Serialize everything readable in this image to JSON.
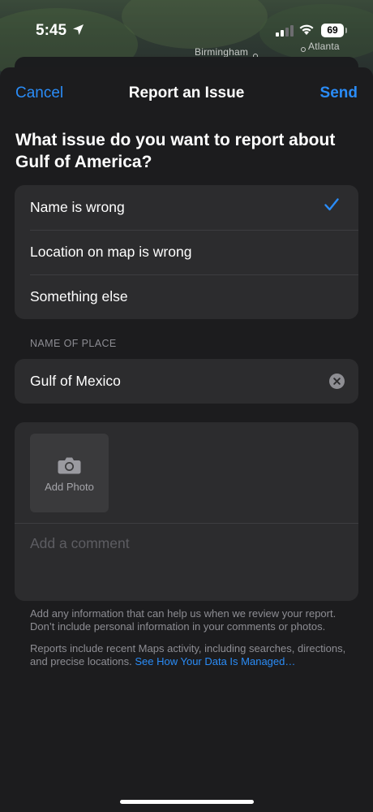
{
  "status_bar": {
    "time": "5:45",
    "battery": "69"
  },
  "map": {
    "labels": [
      "Birmingham",
      "Atlanta"
    ]
  },
  "nav": {
    "cancel_label": "Cancel",
    "title": "Report an Issue",
    "send_label": "Send"
  },
  "question": "What issue do you want to report about Gulf of America?",
  "options": [
    {
      "label": "Name is wrong",
      "selected": true
    },
    {
      "label": "Location on map is wrong",
      "selected": false
    },
    {
      "label": "Something else",
      "selected": false
    }
  ],
  "name_section": {
    "label": "NAME OF PLACE",
    "value": "Gulf of Mexico"
  },
  "photo": {
    "add_photo_label": "Add Photo",
    "comment_placeholder": "Add a comment"
  },
  "footnotes": {
    "info": "Add any information that can help us when we review your report. Don’t include personal information in your comments or photos.",
    "reports_prefix": "Reports include recent Maps activity, including searches, directions, and precise locations. ",
    "data_link": "See How Your Data Is Managed…"
  },
  "colors": {
    "accent": "#2a8cf7",
    "sheet": "#1c1c1e",
    "card": "#2c2c2e"
  },
  "icons": [
    "location-arrow-icon",
    "cellular-signal-icon",
    "wifi-icon",
    "battery-icon",
    "checkmark-icon",
    "clear-icon",
    "camera-icon"
  ]
}
